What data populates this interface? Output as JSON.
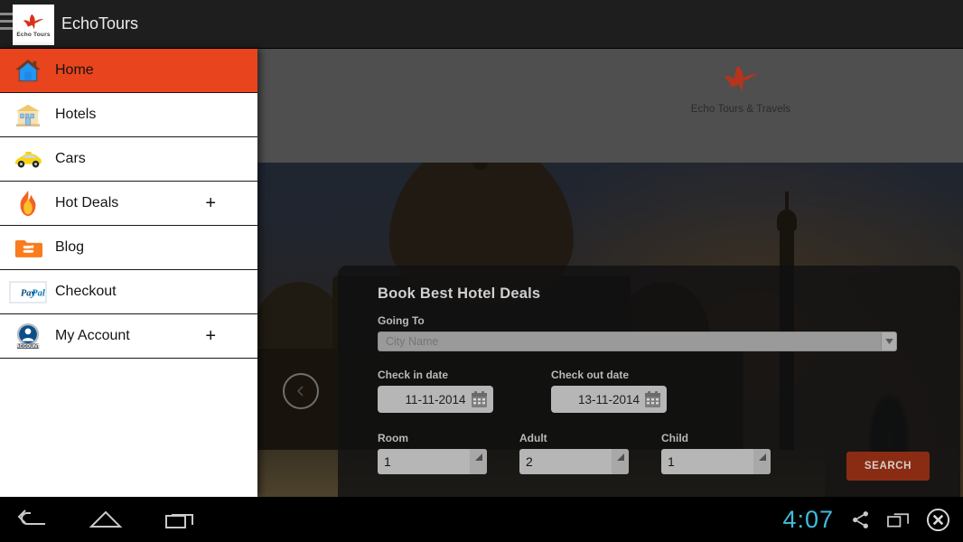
{
  "appbar": {
    "menu_icon": "hamburger-icon",
    "logo_tile_text": "Echo Tours",
    "title": "EchoTours"
  },
  "site": {
    "brand": "Echo Tours & Travels",
    "logo_icon": "bird-logo-icon"
  },
  "carousel": {
    "prev_icon": "chevron-left-icon"
  },
  "booking": {
    "heading": "Book Best Hotel Deals",
    "going_to_label": "Going To",
    "city_placeholder": "City Name",
    "city_value": "",
    "dropdown_icon": "caret-down-icon",
    "checkin_label": "Check in date",
    "checkin_value": "11-11-2014",
    "checkout_label": "Check out date",
    "checkout_value": "13-11-2014",
    "calendar_icon": "calendar-icon",
    "room_label": "Room",
    "room_value": "1",
    "adult_label": "Adult",
    "adult_value": "2",
    "child_label": "Child",
    "child_value": "1",
    "search_label": "SEARCH",
    "search_color": "#8a2c14"
  },
  "drawer": {
    "active_color": "#e8441e",
    "items": [
      {
        "label": "Home",
        "icon": "house-icon",
        "expander": "",
        "active": true
      },
      {
        "label": "Hotels",
        "icon": "hotel-icon",
        "expander": "",
        "active": false
      },
      {
        "label": "Cars",
        "icon": "taxi-icon",
        "expander": "",
        "active": false
      },
      {
        "label": "Hot Deals",
        "icon": "flame-icon",
        "expander": "+",
        "active": false
      },
      {
        "label": "Blog",
        "icon": "blogger-icon",
        "expander": "",
        "active": false
      },
      {
        "label": "Checkout",
        "icon": "paypal-icon",
        "expander": "",
        "active": false
      },
      {
        "label": "My Account",
        "icon": "account-icon",
        "expander": "+",
        "active": false
      }
    ]
  },
  "sysbar": {
    "back_icon": "back-arrow-icon",
    "home_icon": "home-pentagon-icon",
    "recents_icon": "recent-apps-icon",
    "clock": "4:07",
    "share_icon": "share-icon",
    "screenshot_icon": "window-icon",
    "close_icon": "close-circle-icon",
    "clock_color": "#3fbcdd"
  }
}
